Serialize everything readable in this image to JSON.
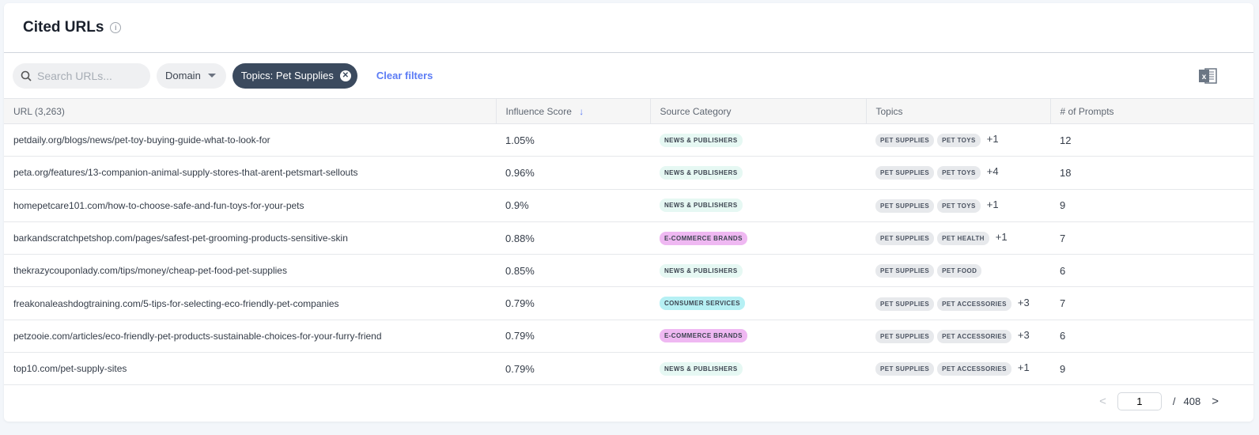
{
  "header": {
    "title": "Cited URLs"
  },
  "filters": {
    "search_placeholder": "Search URLs...",
    "domain_label": "Domain",
    "active_chip": "Topics: Pet Supplies",
    "clear_label": "Clear filters"
  },
  "table": {
    "columns": [
      "URL (3,263)",
      "Influence Score",
      "Source Category",
      "Topics",
      "# of Prompts"
    ],
    "rows": [
      {
        "url": "petdaily.org/blogs/news/pet-toy-buying-guide-what-to-look-for",
        "score": "1.05%",
        "category": "NEWS & PUBLISHERS",
        "cat_type": "news",
        "topics": [
          "PET SUPPLIES",
          "PET TOYS"
        ],
        "more": "+1",
        "prompts": "12"
      },
      {
        "url": "peta.org/features/13-companion-animal-supply-stores-that-arent-petsmart-sellouts",
        "score": "0.96%",
        "category": "NEWS & PUBLISHERS",
        "cat_type": "news",
        "topics": [
          "PET SUPPLIES",
          "PET TOYS"
        ],
        "more": "+4",
        "prompts": "18"
      },
      {
        "url": "homepetcare101.com/how-to-choose-safe-and-fun-toys-for-your-pets",
        "score": "0.9%",
        "category": "NEWS & PUBLISHERS",
        "cat_type": "news",
        "topics": [
          "PET SUPPLIES",
          "PET TOYS"
        ],
        "more": "+1",
        "prompts": "9"
      },
      {
        "url": "barkandscratchpetshop.com/pages/safest-pet-grooming-products-sensitive-skin",
        "score": "0.88%",
        "category": "E-COMMERCE BRANDS",
        "cat_type": "ecom",
        "topics": [
          "PET SUPPLIES",
          "PET HEALTH"
        ],
        "more": "+1",
        "prompts": "7"
      },
      {
        "url": "thekrazycouponlady.com/tips/money/cheap-pet-food-pet-supplies",
        "score": "0.85%",
        "category": "NEWS & PUBLISHERS",
        "cat_type": "news",
        "topics": [
          "PET SUPPLIES",
          "PET FOOD"
        ],
        "more": "",
        "prompts": "6"
      },
      {
        "url": "freakonaleashdogtraining.com/5-tips-for-selecting-eco-friendly-pet-companies",
        "score": "0.79%",
        "category": "CONSUMER SERVICES",
        "cat_type": "consumer",
        "topics": [
          "PET SUPPLIES",
          "PET ACCESSORIES"
        ],
        "more": "+3",
        "prompts": "7"
      },
      {
        "url": "petzooie.com/articles/eco-friendly-pet-products-sustainable-choices-for-your-furry-friend",
        "score": "0.79%",
        "category": "E-COMMERCE BRANDS",
        "cat_type": "ecom",
        "topics": [
          "PET SUPPLIES",
          "PET ACCESSORIES"
        ],
        "more": "+3",
        "prompts": "6"
      },
      {
        "url": "top10.com/pet-supply-sites",
        "score": "0.79%",
        "category": "NEWS & PUBLISHERS",
        "cat_type": "news",
        "topics": [
          "PET SUPPLIES",
          "PET ACCESSORIES"
        ],
        "more": "+1",
        "prompts": "9"
      }
    ]
  },
  "pagination": {
    "current": "1",
    "separator": "/",
    "total": "408"
  },
  "colors": {
    "news": "#e6f8f3",
    "ecom": "#efb8f2",
    "consumer": "#b6f0f4",
    "accent": "#5c7cf5",
    "chip": "#3b4a5e"
  }
}
